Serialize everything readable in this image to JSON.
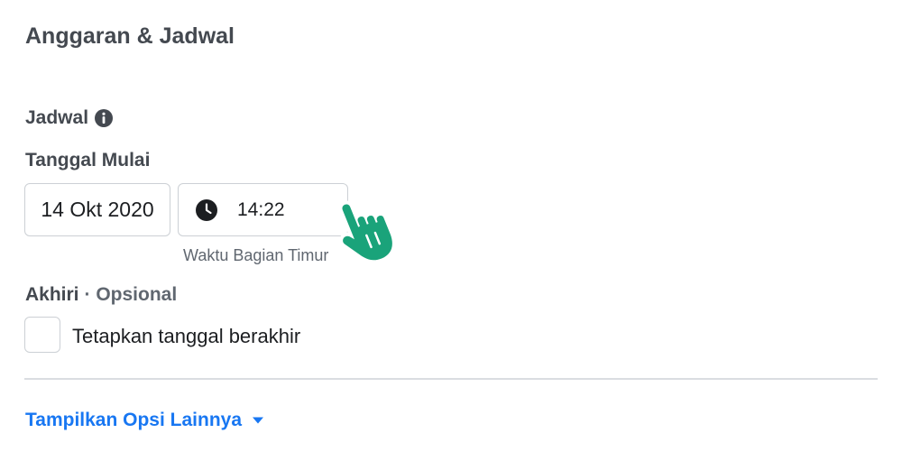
{
  "section": {
    "title": "Anggaran & Jadwal"
  },
  "schedule": {
    "label": "Jadwal",
    "info_icon": "info-icon"
  },
  "start": {
    "label": "Tanggal Mulai",
    "date_value": "14 Okt 2020",
    "time_value": "14:22",
    "clock_icon": "clock-icon",
    "timezone": "Waktu Bagian Timur"
  },
  "end": {
    "label": "Akhiri",
    "optional": "· Opsional",
    "checkbox_label": "Tetapkan tanggal berakhir",
    "checked": false
  },
  "more": {
    "label": "Tampilkan Opsi Lainnya",
    "caret_icon": "caret-down-icon"
  },
  "cursor": {
    "icon": "pointer-hand-icon",
    "color": "#1aa37a"
  },
  "colors": {
    "heading": "#444950",
    "link": "#1877f2",
    "border": "#ccd0d5",
    "divider": "#dadde1"
  }
}
